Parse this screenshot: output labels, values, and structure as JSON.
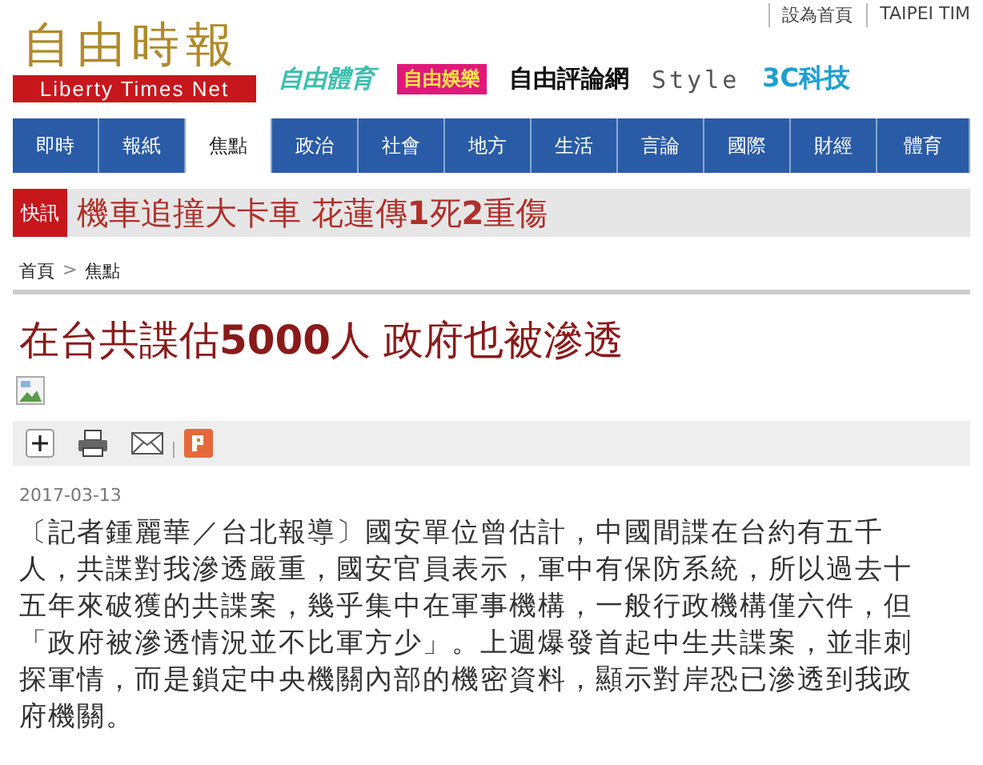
{
  "top_links": [
    "設為首頁",
    "TAIPEI TIM"
  ],
  "logo": {
    "title": "自由時報",
    "subtitle": "Liberty Times Net"
  },
  "partners": [
    {
      "kind": "sports",
      "label": "自由體育"
    },
    {
      "kind": "ent",
      "label": "自由娛樂"
    },
    {
      "kind": "opinion",
      "label": "自由評論網"
    },
    {
      "kind": "style",
      "label": "Style"
    },
    {
      "kind": "tech",
      "label": "3C科技"
    }
  ],
  "nav": [
    {
      "label": "即時",
      "selected": false
    },
    {
      "label": "報紙",
      "selected": false
    },
    {
      "label": "焦點",
      "selected": true
    },
    {
      "label": "政治",
      "selected": false
    },
    {
      "label": "社會",
      "selected": false
    },
    {
      "label": "地方",
      "selected": false
    },
    {
      "label": "生活",
      "selected": false
    },
    {
      "label": "言論",
      "selected": false
    },
    {
      "label": "國際",
      "selected": false
    },
    {
      "label": "財經",
      "selected": false
    },
    {
      "label": "體育",
      "selected": false
    }
  ],
  "breaking": {
    "label": "快訊",
    "headline": "機車追撞大卡車 花蓮傳**1**死**2**重傷"
  },
  "breadcrumb": {
    "items": [
      "首頁",
      "焦點"
    ],
    "separator": ">"
  },
  "article": {
    "title": "在台共諜估**5000**人 政府也被滲透",
    "date": "2017-03-13",
    "body": "〔記者鍾麗華／台北報導〕國安單位曾估計，中國間諜在台約有五千人，共諜對我滲透嚴重，國安官員表示，軍中有保防系統，所以過去十五年來破獲的共諜案，幾乎集中在軍事機構，一般行政機構僅六件，但「政府被滲透情況並不比軍方少」。上週爆發首起中生共諜案，並非刺探軍情，而是鎖定中央機關內部的機密資料，顯示對岸恐已滲透到我政府機關。"
  }
}
